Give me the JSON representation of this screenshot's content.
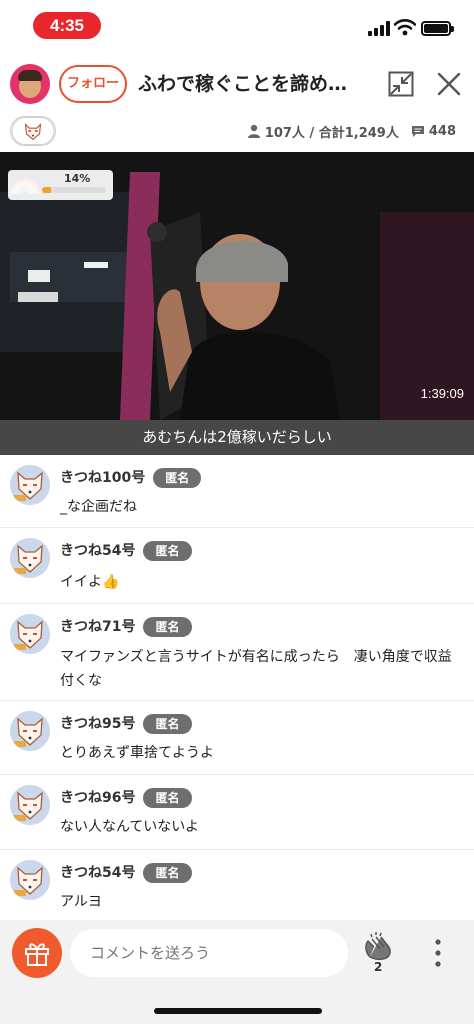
{
  "status_bar": {
    "time": "4:35"
  },
  "header": {
    "follow_label": "フォロー",
    "title": "ふわで稼ぐことを諦め…"
  },
  "stats": {
    "viewers": "107人 / 合計1,249人",
    "comments_count": "448"
  },
  "video": {
    "rainbow_percent": "14%",
    "rainbow_progress": 0.14,
    "duration": "1:39:09",
    "caption": "あむちんは2億稼いだらしい"
  },
  "anon_label": "匿名",
  "comments": [
    {
      "name": "きつね100号",
      "text": "_な企画だね"
    },
    {
      "name": "きつね54号",
      "text": "イイよ👍"
    },
    {
      "name": "きつね71号",
      "text": "マイファンズと言うサイトが有名に成ったら　凄い角度で収益付くな"
    },
    {
      "name": "きつね95号",
      "text": "とりあえず車捨てようよ"
    },
    {
      "name": "きつね96号",
      "text": "ない人なんていないよ"
    },
    {
      "name": "きつね54号",
      "text": "アルヨ"
    }
  ],
  "footer": {
    "comment_placeholder": "コメントを送ろう",
    "clap_count": "2"
  },
  "colors": {
    "accent": "#e8502e",
    "status_pill": "#e8262c",
    "gift": "#f05a2c",
    "anon_badge": "#6e6e6e"
  },
  "icons": [
    "signal-icon",
    "wifi-icon",
    "battery-icon",
    "minimize-icon",
    "close-icon",
    "fox-icon",
    "person-icon",
    "comment-icon",
    "rainbow-icon",
    "gift-icon",
    "clap-icon",
    "more-icon"
  ]
}
